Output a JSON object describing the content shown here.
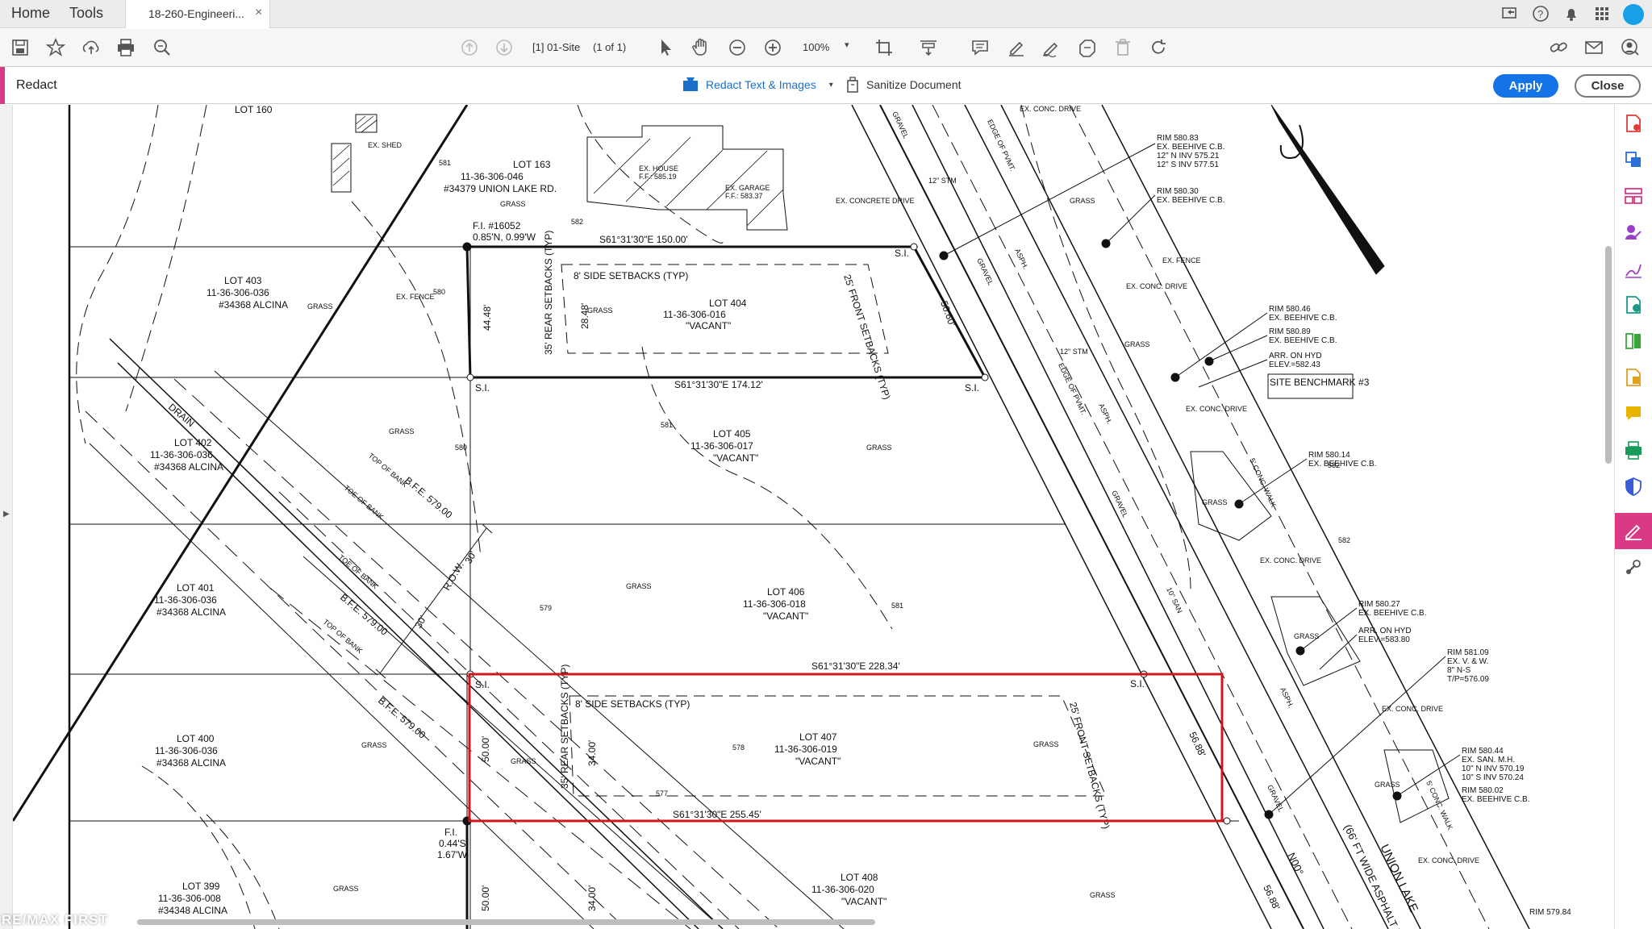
{
  "tabs": {
    "home": "Home",
    "tools": "Tools",
    "document": "18-260-Engineeri...",
    "close_glyph": "×"
  },
  "toolbar": {
    "page_field": "[1] 01-Site",
    "page_of": "(1 of 1)",
    "zoom": "100%"
  },
  "redact": {
    "title": "Redact",
    "redact_tool": "Redact Text & Images",
    "sanitize_tool": "Sanitize Document",
    "apply": "Apply",
    "close": "Close"
  },
  "icons": {
    "topright": [
      "share-screen-icon",
      "help-icon",
      "bell-icon",
      "apps-grid-icon",
      "user-avatar"
    ],
    "toolbar": [
      "save-icon",
      "star-icon",
      "upload-icon",
      "print-icon",
      "search-icon",
      "prev-page-icon",
      "next-page-icon",
      "select-arrow-icon",
      "hand-icon",
      "zoom-out-icon",
      "zoom-in-icon",
      "crop-icon",
      "fit-page-icon",
      "comment-icon",
      "highlight-icon",
      "sign-icon",
      "stamp-icon",
      "delete-icon",
      "rotate-icon",
      "link-icon",
      "mail-icon",
      "account-icon"
    ],
    "right_panel": [
      "export-pdf-icon",
      "create-pdf-icon",
      "organize-pages-icon",
      "fill-sign-icon",
      "edit-pdf-icon",
      "combine-icon",
      "compress-icon",
      "send-review-icon",
      "comment-panel-icon",
      "scan-icon",
      "protect-icon",
      "redact-icon",
      "more-tools-icon"
    ]
  },
  "drawing": {
    "lots": [
      {
        "name": "LOT 160"
      },
      {
        "name": "LOT 163",
        "id": "11-36-306-046",
        "addr": "#34379 UNION LAKE RD."
      },
      {
        "name": "LOT 403",
        "id": "11-36-306-036",
        "addr": "#34368 ALCINA"
      },
      {
        "name": "LOT 404",
        "id": "11-36-306-016",
        "addr": "\"VACANT\""
      },
      {
        "name": "LOT 402",
        "id": "11-36-306-036",
        "addr": "#34368 ALCINA"
      },
      {
        "name": "LOT 405",
        "id": "11-36-306-017",
        "addr": "\"VACANT\""
      },
      {
        "name": "LOT 401",
        "id": "11-36-306-036",
        "addr": "#34368 ALCINA"
      },
      {
        "name": "LOT 406",
        "id": "11-36-306-018",
        "addr": "\"VACANT\""
      },
      {
        "name": "LOT 400",
        "id": "11-36-306-036",
        "addr": "#34368 ALCINA"
      },
      {
        "name": "LOT 407",
        "id": "11-36-306-019",
        "addr": "\"VACANT\""
      },
      {
        "name": "LOT 399",
        "id": "11-36-306-008",
        "addr": "#34348 ALCINA"
      },
      {
        "name": "LOT 408",
        "id": "11-36-306-020",
        "addr": "\"VACANT\""
      }
    ],
    "bearings": [
      "S61°31'30\"E 150.00'",
      "S61°31'30\"E 174.12'",
      "S61°31'30\"E 228.34'",
      "S61°31'30\"E 255.45'"
    ],
    "dims": [
      "44.48'",
      "28.48'",
      "50.60'",
      "50.00'",
      "34.00'",
      "56.88'",
      "30'",
      "30'",
      "50.00'",
      "34.00'",
      "56.88'"
    ],
    "setbacks": [
      "8' SIDE SETBACKS (TYP)",
      "35' REAR SETBACKS (TYP)",
      "25' FRONT SETBACKS (TYP)"
    ],
    "labels": {
      "fi_1": "F.I. #16052",
      "fi_1b": "0.85'N, 0.99'W",
      "fi_2": "F.I.",
      "fi_2b": "0.44'S",
      "fi_2c": "1.67'W",
      "si": "S.I.",
      "ex_shed": "EX. SHED",
      "ex_house": "EX. HOUSE",
      "ex_house_ff": "F.F.: 585.19",
      "ex_garage": "EX. GARAGE",
      "ex_garage_ff": "F.F.: 583.37",
      "ex_concrete": "EX. CONCRETE DRIVE",
      "ex_fence": "EX. FENCE",
      "grass": "GRASS",
      "gravel": "GRAVEL",
      "asph": "ASPH.",
      "drain": "DRAIN",
      "top_bank": "TOP OF BANK",
      "toe_bank": "TOE OF BANK",
      "bfe": "B.F.E. 579.00",
      "row": "R.O.W.",
      "stm": "12\" STM",
      "san": "10\" SAN",
      "edge_pvmt": "EDGE OF PVMT.",
      "union_lake": "UNION LAKE",
      "asphalt_road": "(66' FT WIDE ASPHALT R.O.",
      "bearing_road": "N00°",
      "site_benchmark": "SITE BENCHMARK #3",
      "ex_conc_drive": "EX. CONC. DRIVE",
      "conc_walk": "5' CONC. WALK"
    },
    "callouts": [
      [
        "RIM 580.83",
        "EX. BEEHIVE C.B.",
        "12\" N INV 575.21",
        "12\" S INV 577.51"
      ],
      [
        "RIM 580.30",
        "EX. BEEHIVE C.B."
      ],
      [
        "RIM 580.46",
        "EX. BEEHIVE C.B."
      ],
      [
        "RIM 580.89",
        "EX. BEEHIVE C.B."
      ],
      [
        "ARR. ON HYD",
        "ELEV.=582.43"
      ],
      [
        "RIM 580.14",
        "EX. BEEHIVE C.B."
      ],
      [
        "RIM 580.27",
        "EX. BEEHIVE C.B."
      ],
      [
        "ARR. ON HYD",
        "ELEV.=583.80"
      ],
      [
        "RIM 581.09",
        "EX. V. & W.",
        "8\" N-S",
        "T/P=576.09"
      ],
      [
        "RIM 580.44",
        "EX. SAN. M.H.",
        "10\" N INV 570.19",
        "10\" S INV 570.24"
      ],
      [
        "RIM 580.02",
        "EX. BEEHIVE C.B."
      ],
      [
        "RIM 579.84"
      ]
    ],
    "contours": [
      "581",
      "582",
      "580",
      "578",
      "577",
      "579",
      "582",
      "581",
      "580",
      "581",
      "582"
    ]
  },
  "watermark": "RE/MAX FIRST",
  "colors": {
    "accent_pink": "#d93a85",
    "apply_blue": "#1473e6",
    "redaction_red": "#d0161d"
  }
}
